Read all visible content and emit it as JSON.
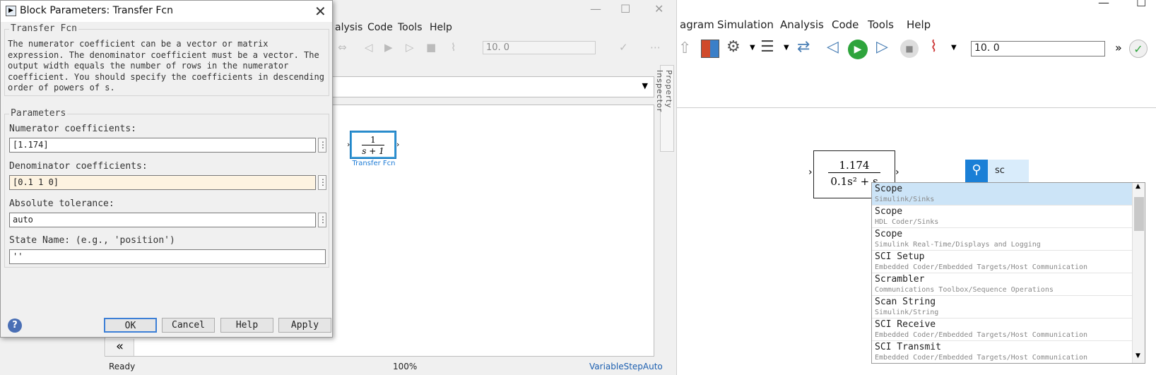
{
  "mid_window": {
    "controls": {
      "minimize": "—",
      "maximize": "☐",
      "close": "✕"
    },
    "menu": [
      "alysis",
      "Code",
      "Tools",
      "Help"
    ],
    "stop_time": "10. 0",
    "property_inspector": "Property Inspector",
    "block": {
      "numerator": "1",
      "denominator": "s + 1",
      "caption": "Transfer Fcn"
    },
    "collapse": "«",
    "status": {
      "ready": "Ready",
      "zoom": "100%",
      "solver": "VariableStepAuto"
    }
  },
  "dialog": {
    "title": "Block Parameters: Transfer Fcn",
    "close": "✕",
    "group_title": "Transfer Fcn",
    "description": "The numerator coefficient can be a vector or matrix expression. The denominator coefficient must be a vector. The output width equals the number of rows in the numerator coefficient. You should specify the coefficients in descending order of powers of s.",
    "parameters_title": "Parameters",
    "numerator_label": "Numerator coefficients:",
    "numerator_value": "[1.174]",
    "denominator_label": "Denominator coefficients:",
    "denominator_value": "[0.1 1 0]",
    "tolerance_label": "Absolute tolerance:",
    "tolerance_value": "auto",
    "statename_label": "State Name: (e.g., 'position')",
    "statename_value": "''",
    "buttons": {
      "ok": "OK",
      "cancel": "Cancel",
      "help": "Help",
      "apply": "Apply"
    },
    "help_icon": "?"
  },
  "right_window": {
    "controls": {
      "minimize": "—",
      "maximize": "☐"
    },
    "menu": [
      "agram",
      "Simulation",
      "Analysis",
      "Code",
      "Tools",
      "Help"
    ],
    "stop_time": "10. 0",
    "more": "»",
    "block": {
      "numerator": "1.174",
      "denominator": "0.1s² + s"
    },
    "search_text": "sc",
    "suggestions": [
      {
        "title": "Scope",
        "path": "Simulink/Sinks",
        "selected": true
      },
      {
        "title": "Scope",
        "path": "HDL Coder/Sinks"
      },
      {
        "title": "Scope",
        "path": "Simulink Real-Time/Displays and Logging"
      },
      {
        "title": "SCI Setup",
        "path": "Embedded Coder/Embedded Targets/Host Communication"
      },
      {
        "title": "Scrambler",
        "path": "Communications Toolbox/Sequence Operations"
      },
      {
        "title": "Scan String",
        "path": "Simulink/String"
      },
      {
        "title": "SCI Receive",
        "path": "Embedded Coder/Embedded Targets/Host Communication"
      },
      {
        "title": "SCI Transmit",
        "path": "Embedded Coder/Embedded Targets/Host Communication"
      }
    ]
  },
  "colors": {
    "accent": "#1a7fd6",
    "selection": "#cce4f7",
    "denominator_bg": "#fdf3e1"
  }
}
